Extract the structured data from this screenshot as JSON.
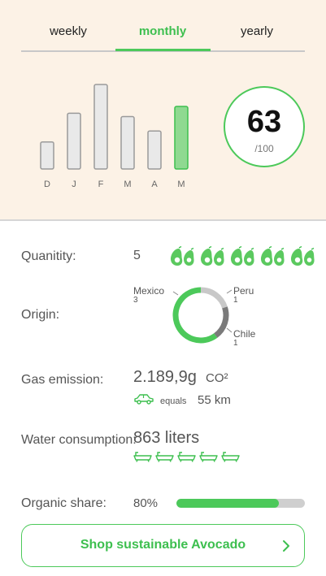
{
  "tabs": [
    {
      "label": "weekly",
      "active": false
    },
    {
      "label": "monthly",
      "active": true
    },
    {
      "label": "yearly",
      "active": false
    }
  ],
  "chart_data": {
    "type": "bar",
    "categories": [
      "D",
      "J",
      "F",
      "M",
      "A",
      "M"
    ],
    "values": [
      32,
      66,
      100,
      62,
      45,
      74
    ],
    "highlight_index": 5,
    "colors": {
      "default": "#e9e9e9",
      "default_stroke": "#9a9a9a",
      "highlight": "#8fd991",
      "highlight_stroke": "#3dbf4f"
    }
  },
  "score": {
    "value": "63",
    "max": "/100"
  },
  "quantity": {
    "label": "Quanitity:",
    "value": "5",
    "icon": "avocado-icon",
    "icon_count": 5
  },
  "origin": {
    "label": "Origin:",
    "slices": [
      {
        "name": "Mexico",
        "count": "3",
        "color": "#4cc95a"
      },
      {
        "name": "Peru",
        "count": "1",
        "color": "#c8c8c8"
      },
      {
        "name": "Chile",
        "count": "1",
        "color": "#7a7a7a"
      }
    ]
  },
  "gas": {
    "label": "Gas emission:",
    "value": "2.189,9g",
    "unit": "CO²",
    "equals": "equals",
    "distance": "55 km",
    "icon": "car-icon"
  },
  "water": {
    "label": "Water consumption:",
    "value": "863 liters",
    "icon": "bathtub-icon",
    "icon_count": 5
  },
  "organic": {
    "label": "Organic share:",
    "value": "80%",
    "fraction": 0.8
  },
  "shop_button": {
    "label": "Shop sustainable Avocado",
    "icon": "chevron-right-icon"
  },
  "accent_color": "#4cc95a"
}
